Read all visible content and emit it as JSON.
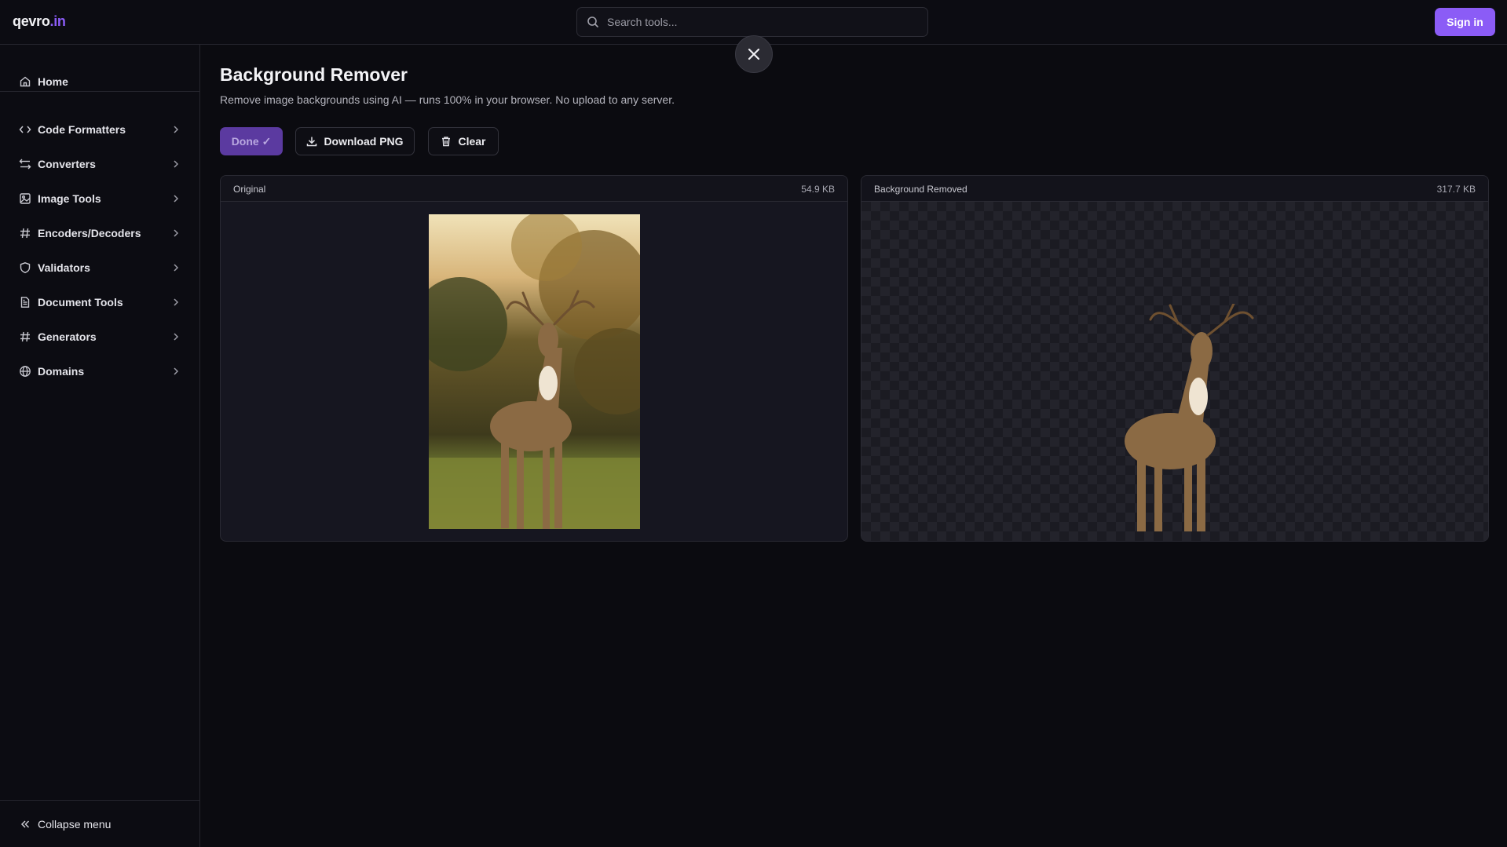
{
  "header": {
    "logo_name": "qevro",
    "logo_tld": ".in",
    "search_placeholder": "Search tools...",
    "signin_label": "Sign in"
  },
  "sidebar": {
    "home": "Home",
    "items": [
      {
        "label": "Code Formatters",
        "icon": "code-icon"
      },
      {
        "label": "Converters",
        "icon": "arrows-icon"
      },
      {
        "label": "Image Tools",
        "icon": "image-icon"
      },
      {
        "label": "Encoders/Decoders",
        "icon": "hash-icon"
      },
      {
        "label": "Validators",
        "icon": "shield-icon"
      },
      {
        "label": "Document Tools",
        "icon": "document-icon"
      },
      {
        "label": "Generators",
        "icon": "hash-icon"
      },
      {
        "label": "Domains",
        "icon": "globe-icon"
      }
    ],
    "collapse_label": "Collapse menu"
  },
  "main": {
    "title": "Background Remover",
    "subtitle": "Remove image backgrounds using AI — runs 100% in your browser. No upload to any server.",
    "buttons": {
      "done": "Done ✓",
      "download": "Download PNG",
      "clear": "Clear"
    },
    "panels": {
      "original": {
        "label": "Original",
        "size": "54.9 KB"
      },
      "removed": {
        "label": "Background Removed",
        "size": "317.7 KB"
      }
    }
  },
  "colors": {
    "accent": "#8b5cf6",
    "background": "#0b0b10"
  }
}
